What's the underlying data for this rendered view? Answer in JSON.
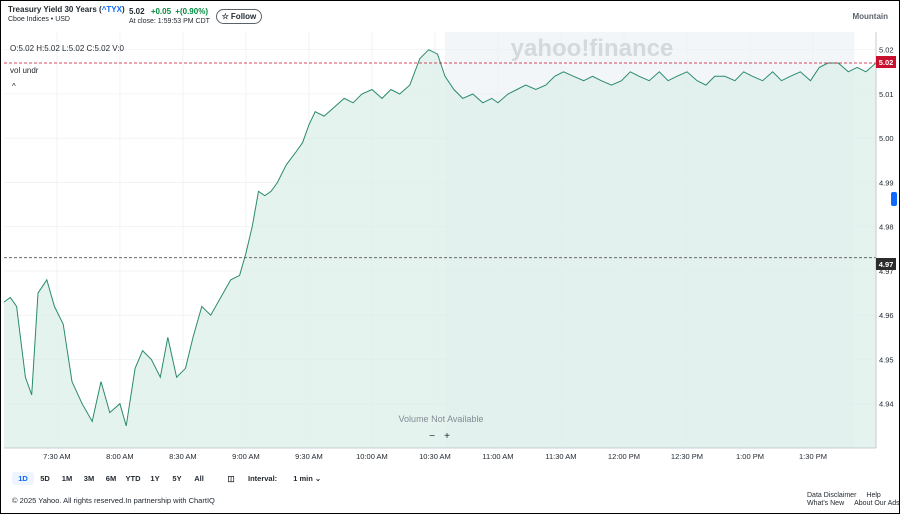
{
  "header": {
    "title_prefix": "Treasury Yield 30 Years (",
    "symbol": "^TYX",
    "title_suffix": ")",
    "exchange": "Cboe Indices • USD",
    "price": "5.02",
    "change": "+0.05",
    "change_pct": "+(0.90%)",
    "close_time": "At close: 1:59:53 PM CDT",
    "follow_label": "Follow",
    "follow_icon": "star-icon",
    "timezone": "Mountain"
  },
  "ohlc": "O:5.02  H:5.02  L:5.02  C:5.02  V:0",
  "vol_label": "vol undr",
  "watermark": "yahoo!finance",
  "volume_note": "Volume Not Available",
  "zoom": {
    "minus": "−",
    "plus": "+"
  },
  "price_tags": {
    "current": "5.02",
    "reference": "4.97"
  },
  "toolbar": {
    "ranges": [
      "1D",
      "5D",
      "1M",
      "3M",
      "6M",
      "YTD",
      "1Y",
      "5Y",
      "All"
    ],
    "active_range": "1D",
    "interval_label": "Interval:",
    "interval_value": "1 min"
  },
  "footer": {
    "copyright": "© 2025 Yahoo. All rights reserved.In partnership with ChartIQ",
    "data_disclaimer": "Data Disclaimer",
    "help": "Help",
    "whats_new": "What's New",
    "about_ads": "About Our Ads"
  },
  "colors": {
    "line": "#2a8a6c",
    "fill": "#dcefe9",
    "accent": "#0f69ff",
    "up": "#008a3e",
    "current_tag": "#c8102e",
    "ref_tag": "#2c2c2c"
  },
  "chart_data": {
    "type": "area",
    "title": "",
    "xlabel": "",
    "ylabel": "",
    "x_ticks": [
      "7:30 AM",
      "8:00 AM",
      "8:30 AM",
      "9:00 AM",
      "9:30 AM",
      "10:00 AM",
      "10:30 AM",
      "11:00 AM",
      "11:30 AM",
      "12:00 PM",
      "12:30 PM",
      "1:00 PM",
      "1:30 PM"
    ],
    "y_ticks": [
      "4.94",
      "4.95",
      "4.96",
      "4.97",
      "4.98",
      "4.99",
      "5.00",
      "5.01",
      "5.02"
    ],
    "ylim": [
      4.93,
      5.024
    ],
    "x_minutes_range": [
      7.08,
      14.0
    ],
    "series": [
      {
        "points": [
          [
            7.08,
            4.963
          ],
          [
            7.13,
            4.964
          ],
          [
            7.18,
            4.962
          ],
          [
            7.25,
            4.946
          ],
          [
            7.3,
            4.942
          ],
          [
            7.35,
            4.965
          ],
          [
            7.42,
            4.968
          ],
          [
            7.48,
            4.962
          ],
          [
            7.55,
            4.958
          ],
          [
            7.62,
            4.945
          ],
          [
            7.7,
            4.94
          ],
          [
            7.78,
            4.936
          ],
          [
            7.85,
            4.945
          ],
          [
            7.92,
            4.938
          ],
          [
            8.0,
            4.94
          ],
          [
            8.05,
            4.935
          ],
          [
            8.12,
            4.948
          ],
          [
            8.18,
            4.952
          ],
          [
            8.25,
            4.95
          ],
          [
            8.32,
            4.946
          ],
          [
            8.38,
            4.955
          ],
          [
            8.45,
            4.946
          ],
          [
            8.52,
            4.948
          ],
          [
            8.58,
            4.955
          ],
          [
            8.65,
            4.962
          ],
          [
            8.72,
            4.96
          ],
          [
            8.8,
            4.964
          ],
          [
            8.88,
            4.968
          ],
          [
            8.95,
            4.969
          ],
          [
            9.0,
            4.974
          ],
          [
            9.05,
            4.98
          ],
          [
            9.1,
            4.988
          ],
          [
            9.15,
            4.987
          ],
          [
            9.2,
            4.988
          ],
          [
            9.25,
            4.99
          ],
          [
            9.32,
            4.994
          ],
          [
            9.4,
            4.997
          ],
          [
            9.45,
            4.999
          ],
          [
            9.5,
            5.003
          ],
          [
            9.55,
            5.006
          ],
          [
            9.62,
            5.005
          ],
          [
            9.7,
            5.007
          ],
          [
            9.78,
            5.009
          ],
          [
            9.85,
            5.008
          ],
          [
            9.92,
            5.01
          ],
          [
            10.0,
            5.011
          ],
          [
            10.08,
            5.009
          ],
          [
            10.15,
            5.011
          ],
          [
            10.22,
            5.01
          ],
          [
            10.3,
            5.012
          ],
          [
            10.38,
            5.018
          ],
          [
            10.45,
            5.02
          ],
          [
            10.52,
            5.019
          ],
          [
            10.58,
            5.014
          ],
          [
            10.65,
            5.011
          ],
          [
            10.72,
            5.009
          ],
          [
            10.8,
            5.01
          ],
          [
            10.88,
            5.008
          ],
          [
            10.95,
            5.009
          ],
          [
            11.0,
            5.008
          ],
          [
            11.08,
            5.01
          ],
          [
            11.15,
            5.011
          ],
          [
            11.22,
            5.012
          ],
          [
            11.3,
            5.011
          ],
          [
            11.38,
            5.012
          ],
          [
            11.45,
            5.014
          ],
          [
            11.52,
            5.015
          ],
          [
            11.6,
            5.014
          ],
          [
            11.68,
            5.013
          ],
          [
            11.75,
            5.014
          ],
          [
            11.82,
            5.013
          ],
          [
            11.9,
            5.012
          ],
          [
            11.98,
            5.013
          ],
          [
            12.05,
            5.015
          ],
          [
            12.12,
            5.014
          ],
          [
            12.2,
            5.013
          ],
          [
            12.28,
            5.015
          ],
          [
            12.35,
            5.013
          ],
          [
            12.42,
            5.014
          ],
          [
            12.5,
            5.015
          ],
          [
            12.58,
            5.013
          ],
          [
            12.65,
            5.012
          ],
          [
            12.72,
            5.014
          ],
          [
            12.8,
            5.014
          ],
          [
            12.88,
            5.013
          ],
          [
            12.95,
            5.015
          ],
          [
            13.02,
            5.014
          ],
          [
            13.1,
            5.013
          ],
          [
            13.18,
            5.015
          ],
          [
            13.25,
            5.013
          ],
          [
            13.32,
            5.014
          ],
          [
            13.4,
            5.015
          ],
          [
            13.48,
            5.013
          ],
          [
            13.55,
            5.016
          ],
          [
            13.62,
            5.017
          ],
          [
            13.7,
            5.017
          ],
          [
            13.78,
            5.015
          ],
          [
            13.85,
            5.016
          ],
          [
            13.92,
            5.015
          ],
          [
            14.0,
            5.017
          ]
        ]
      }
    ],
    "reference_lines": [
      5.017,
      4.973
    ],
    "grid": true,
    "legend": "none"
  }
}
